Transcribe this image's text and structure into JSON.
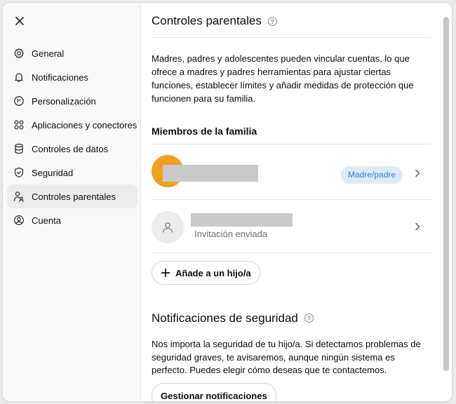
{
  "sidebar": {
    "close_icon": "close-icon",
    "items": [
      {
        "label": "General",
        "icon": "gear-icon",
        "active": false
      },
      {
        "label": "Notificaciones",
        "icon": "bell-icon",
        "active": false
      },
      {
        "label": "Personalización",
        "icon": "palette-icon",
        "active": false
      },
      {
        "label": "Aplicaciones y conectores",
        "icon": "apps-icon",
        "active": false
      },
      {
        "label": "Controles de datos",
        "icon": "database-icon",
        "active": false
      },
      {
        "label": "Seguridad",
        "icon": "shield-icon",
        "active": false
      },
      {
        "label": "Controles parentales",
        "icon": "family-icon",
        "active": true
      },
      {
        "label": "Cuenta",
        "icon": "user-circle-icon",
        "active": false
      }
    ]
  },
  "main": {
    "title": "Controles parentales",
    "help_glyph": "?",
    "description": "Madres, padres y adolescentes pueden vincular cuentas, lo que ofrece a madres y padres herramientas para ajustar ciertas funciones, establecer límites y añadir medidas de protección que funcionen para su familia.",
    "family_section_title": "Miembros de la familia",
    "members": [
      {
        "name": "",
        "role_badge": "Madre/padre",
        "avatar_color": "#f0a020"
      },
      {
        "name": "",
        "status": "Invitación enviada"
      }
    ],
    "add_child_button": "Añade a un hijo/a",
    "safety_title": "Notificaciones de seguridad",
    "safety_description": "Nos importa la seguridad de tu hijo/a. Si detectamos problemas de seguridad graves, te avisaremos, aunque ningún sistema es perfecto. Puedes elegir cómo deseas que te contactemos.",
    "manage_notifications_button": "Gestionar notificaciones"
  },
  "colors": {
    "accent_badge_bg": "#dcebfb",
    "accent_badge_text": "#2f7fd8",
    "sidebar_bg": "#f9f9f9",
    "active_item_bg": "#ececec"
  }
}
